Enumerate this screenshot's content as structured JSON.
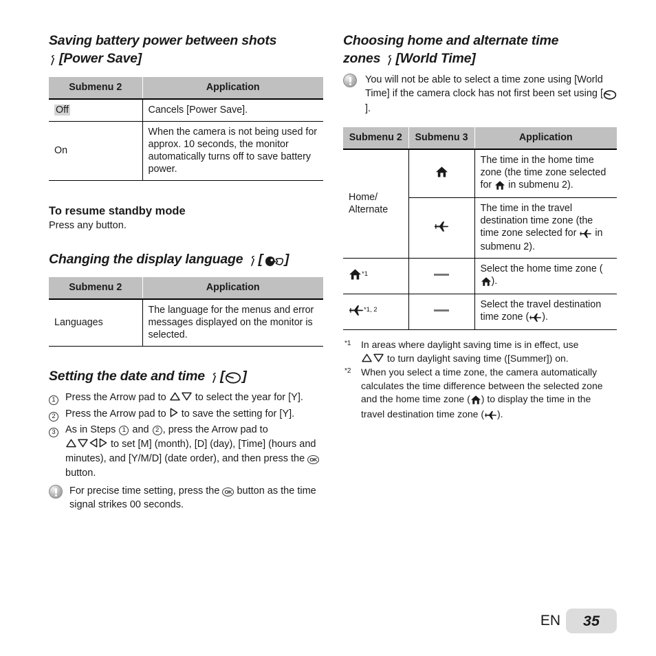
{
  "left": {
    "power_save": {
      "title": "Saving battery power between shots",
      "title2": "[Power Save]",
      "table": {
        "headers": [
          "Submenu 2",
          "Application"
        ],
        "rows": [
          {
            "submenu2": "Off",
            "highlight": true,
            "application": "Cancels [Power Save]."
          },
          {
            "submenu2": "On",
            "highlight": false,
            "application": "When the camera is not being used for approx. 10 seconds, the monitor automatically turns off to save battery power."
          }
        ]
      }
    },
    "standby": {
      "title": "To resume standby mode",
      "body": "Press any button."
    },
    "language": {
      "title": "Changing the display language",
      "table": {
        "headers": [
          "Submenu 2",
          "Application"
        ],
        "rows": [
          {
            "submenu2": "Languages",
            "application": "The language for the menus and error messages displayed on the monitor is selected."
          }
        ]
      }
    },
    "datetime": {
      "title": "Setting the date and time",
      "step1_a": "Press the Arrow pad to",
      "step1_b": "to select the year for [Y].",
      "step2_a": "Press the Arrow pad to",
      "step2_b": "to save the setting for [Y].",
      "step3_a": "As in Steps",
      "step3_and": "and",
      "step3_b": ", press the Arrow pad to",
      "step3_c": "to set [M] (month), [D] (day), [Time] (hours and minutes), and [Y/M/D] (date order), and then press the",
      "step3_d": "button.",
      "note_a": "For precise time setting, press the",
      "note_b": "button as the time signal strikes 00 seconds."
    }
  },
  "right": {
    "world_time": {
      "title": "Choosing home and alternate time",
      "title2": "zones",
      "title3": "[World Time]",
      "note_a": "You will not be able to select a time zone using [World Time] if the camera clock has not first been set using [",
      "note_b": "].",
      "table": {
        "headers": [
          "Submenu 2",
          "Submenu 3",
          "Application"
        ],
        "rows": [
          {
            "submenu2": "Home/ Alternate",
            "submenu2_icon": "",
            "submenu3_icon": "home-icon",
            "application_a": "The time in the home time zone (the time zone selected for",
            "application_icon": "home-icon",
            "application_b": "in submenu 2)."
          },
          {
            "submenu2": "",
            "submenu3_icon": "airplane-icon",
            "application_a": "The time in the travel destination time zone (the time zone selected for",
            "application_icon": "airplane-icon",
            "application_b": "in submenu 2)."
          },
          {
            "submenu2_icon": "home-icon",
            "submenu2_sup": "*1",
            "submenu3": "—",
            "application_a": "Select the home time zone (",
            "application_icon": "home-icon",
            "application_b": ")."
          },
          {
            "submenu2_icon": "airplane-icon",
            "submenu2_sup": "*1, 2",
            "submenu3": "—",
            "application_a": "Select the travel destination time zone (",
            "application_icon": "airplane-icon",
            "application_b": ")."
          }
        ]
      },
      "footnote1_mark": "*1",
      "footnote1_a": "In areas where daylight saving time is in effect, use",
      "footnote1_b": "to turn daylight saving time ([Summer]) on.",
      "footnote2_mark": "*2",
      "footnote2_a": "When you select a time zone, the camera automatically calculates the time difference between the selected zone and the home time zone (",
      "footnote2_b": ") to display the time in the travel destination time zone (",
      "footnote2_c": ")."
    }
  },
  "footer": {
    "language_code": "EN",
    "page_number": "35"
  },
  "icons": {
    "setup_menu": "wrench-icon",
    "clock": "clock-icon",
    "language": "language-icon",
    "home": "home-icon",
    "airplane": "airplane-icon",
    "ok_button": "OK",
    "triangle_up": "▲",
    "triangle_down": "▼",
    "triangle_left": "◀",
    "triangle_right": "▶"
  },
  "colors": {
    "table_header_bg": "#c0c0c0",
    "highlight_bg": "#d4d4d4",
    "page_box_bg": "#dcdcdc",
    "text": "#1a1a1a"
  }
}
